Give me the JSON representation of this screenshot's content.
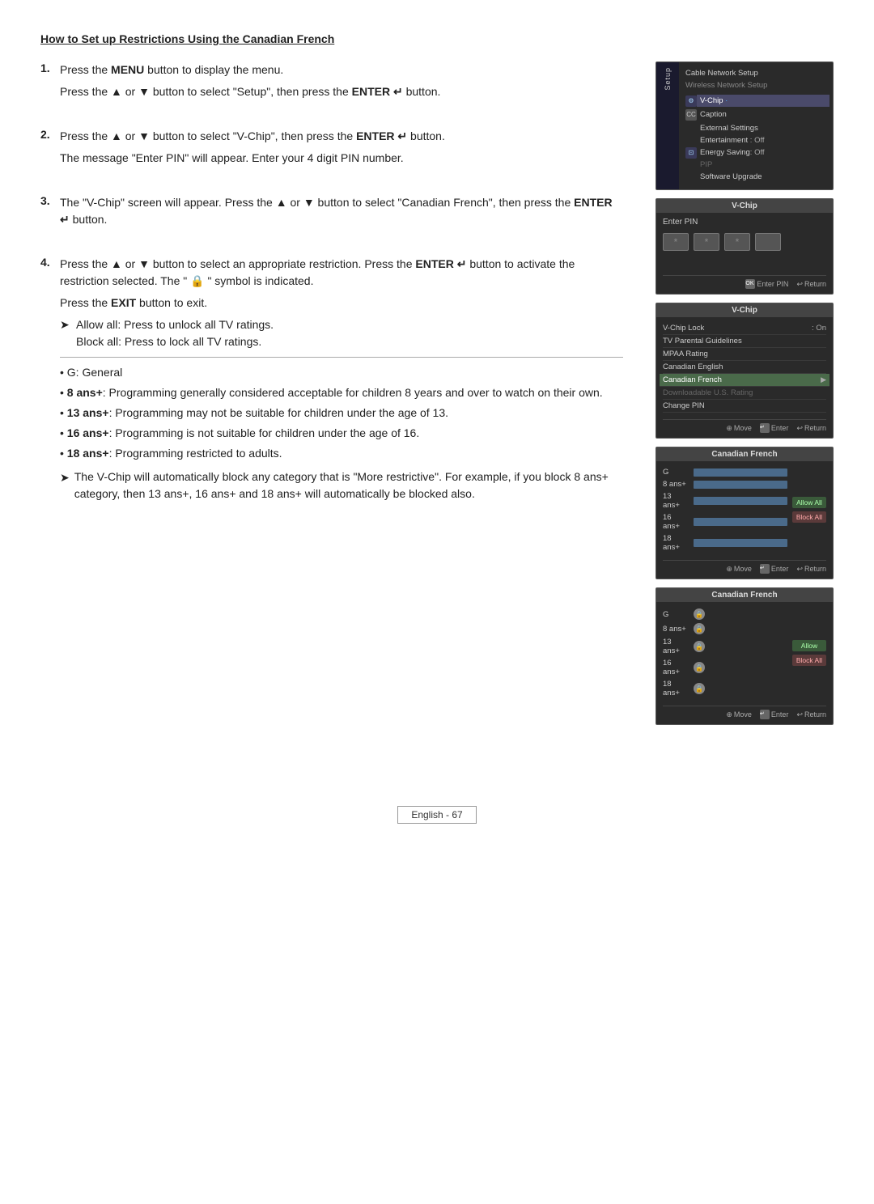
{
  "page": {
    "title": "How to Set up Restrictions Using the Canadian French",
    "footer": "English - 67"
  },
  "steps": [
    {
      "number": "1.",
      "lines": [
        "Press the MENU button to display the menu.",
        "Press the ▲ or ▼ button to select \"Setup\", then press the ENTER ↵ button."
      ]
    },
    {
      "number": "2.",
      "lines": [
        "Press the ▲ or ▼ button to select \"V-Chip\", then press the ENTER ↵ button.",
        "The message \"Enter PIN\" will appear. Enter your 4 digit PIN number."
      ]
    },
    {
      "number": "3.",
      "lines": [
        "The \"V-Chip\" screen will appear. Press the ▲ or ▼ button to select \"Canadian French\", then press the ENTER ↵ button."
      ]
    },
    {
      "number": "4.",
      "lines": [
        "Press the ▲ or ▼ button to select an appropriate restriction. Press the ENTER ↵ button to activate the restriction selected. The \" 🔒 \" symbol is indicated.",
        "Press the EXIT button to exit."
      ],
      "arrow_notes": [
        "Allow all: Press to unlock all TV ratings.",
        "Block all: Press to lock all TV ratings."
      ],
      "bullets": [
        "G: General",
        "8 ans+: Programming generally considered acceptable for children 8 years and over to watch on their own.",
        "13 ans+: Programming may not be suitable for children under the age of 13.",
        "16 ans+: Programming is not suitable for children under the age of 16.",
        "18 ans+: Programming restricted to adults."
      ],
      "block_note": "The V-Chip will automatically block any category that is \"More restrictive\". For example, if you block 8 ans+ category, then 13 ans+, 16 ans+ and 18 ans+ will automatically be blocked also."
    }
  ],
  "screens": {
    "setup_menu": {
      "title": "",
      "sidebar_label": "Setup",
      "items": [
        {
          "label": "Cable Network Setup",
          "value": "",
          "highlighted": false
        },
        {
          "label": "Wireless Network Setup",
          "value": "",
          "highlighted": false
        },
        {
          "label": "V-Chip",
          "value": "·",
          "highlighted": true
        },
        {
          "label": "Caption",
          "value": "",
          "highlighted": false
        },
        {
          "label": "External Settings",
          "value": "",
          "highlighted": false
        },
        {
          "label": "Entertainment",
          "value": ": Off",
          "highlighted": false
        },
        {
          "label": "Energy Saving",
          "value": ": Off",
          "highlighted": false
        },
        {
          "label": "PIP",
          "value": "",
          "highlighted": false
        },
        {
          "label": "Software Upgrade",
          "value": "",
          "highlighted": false
        }
      ]
    },
    "pin_entry": {
      "title": "V-Chip",
      "label": "Enter PIN",
      "footer_enter": "Enter PIN",
      "footer_return": "Return"
    },
    "vchip_menu": {
      "title": "V-Chip",
      "items": [
        {
          "label": "V-Chip Lock",
          "value": ": On"
        },
        {
          "label": "TV Parental Guidelines",
          "value": ""
        },
        {
          "label": "MPAA Rating",
          "value": ""
        },
        {
          "label": "Canadian English",
          "value": ""
        },
        {
          "label": "Canadian French",
          "value": "",
          "highlighted": true,
          "arrow": true
        },
        {
          "label": "Downloadable U.S. Rating",
          "value": "",
          "dimmed": true
        },
        {
          "label": "Change PIN",
          "value": ""
        }
      ],
      "footer_move": "Move",
      "footer_enter": "Enter",
      "footer_return": "Return"
    },
    "cf_screen1": {
      "title": "Canadian French",
      "ratings": [
        {
          "label": "G",
          "bar": true
        },
        {
          "label": "8 ans+",
          "bar": true
        },
        {
          "label": "13 ans+",
          "bar": true
        },
        {
          "label": "16 ans+",
          "bar": true
        },
        {
          "label": "18 ans+",
          "bar": true
        }
      ],
      "allow_all": "Allow All",
      "block_all": "Block All",
      "footer_move": "Move",
      "footer_enter": "Enter",
      "footer_return": "Return"
    },
    "cf_screen2": {
      "title": "Canadian French",
      "ratings": [
        {
          "label": "G",
          "locked": true
        },
        {
          "label": "8 ans+",
          "locked": true
        },
        {
          "label": "13 ans+",
          "locked": true
        },
        {
          "label": "16 ans+",
          "locked": true
        },
        {
          "label": "18 ans+",
          "locked": true
        }
      ],
      "allow_all": "Allow",
      "block_all": "Block All",
      "footer_move": "Move",
      "footer_enter": "Enter",
      "footer_return": "Return"
    }
  }
}
